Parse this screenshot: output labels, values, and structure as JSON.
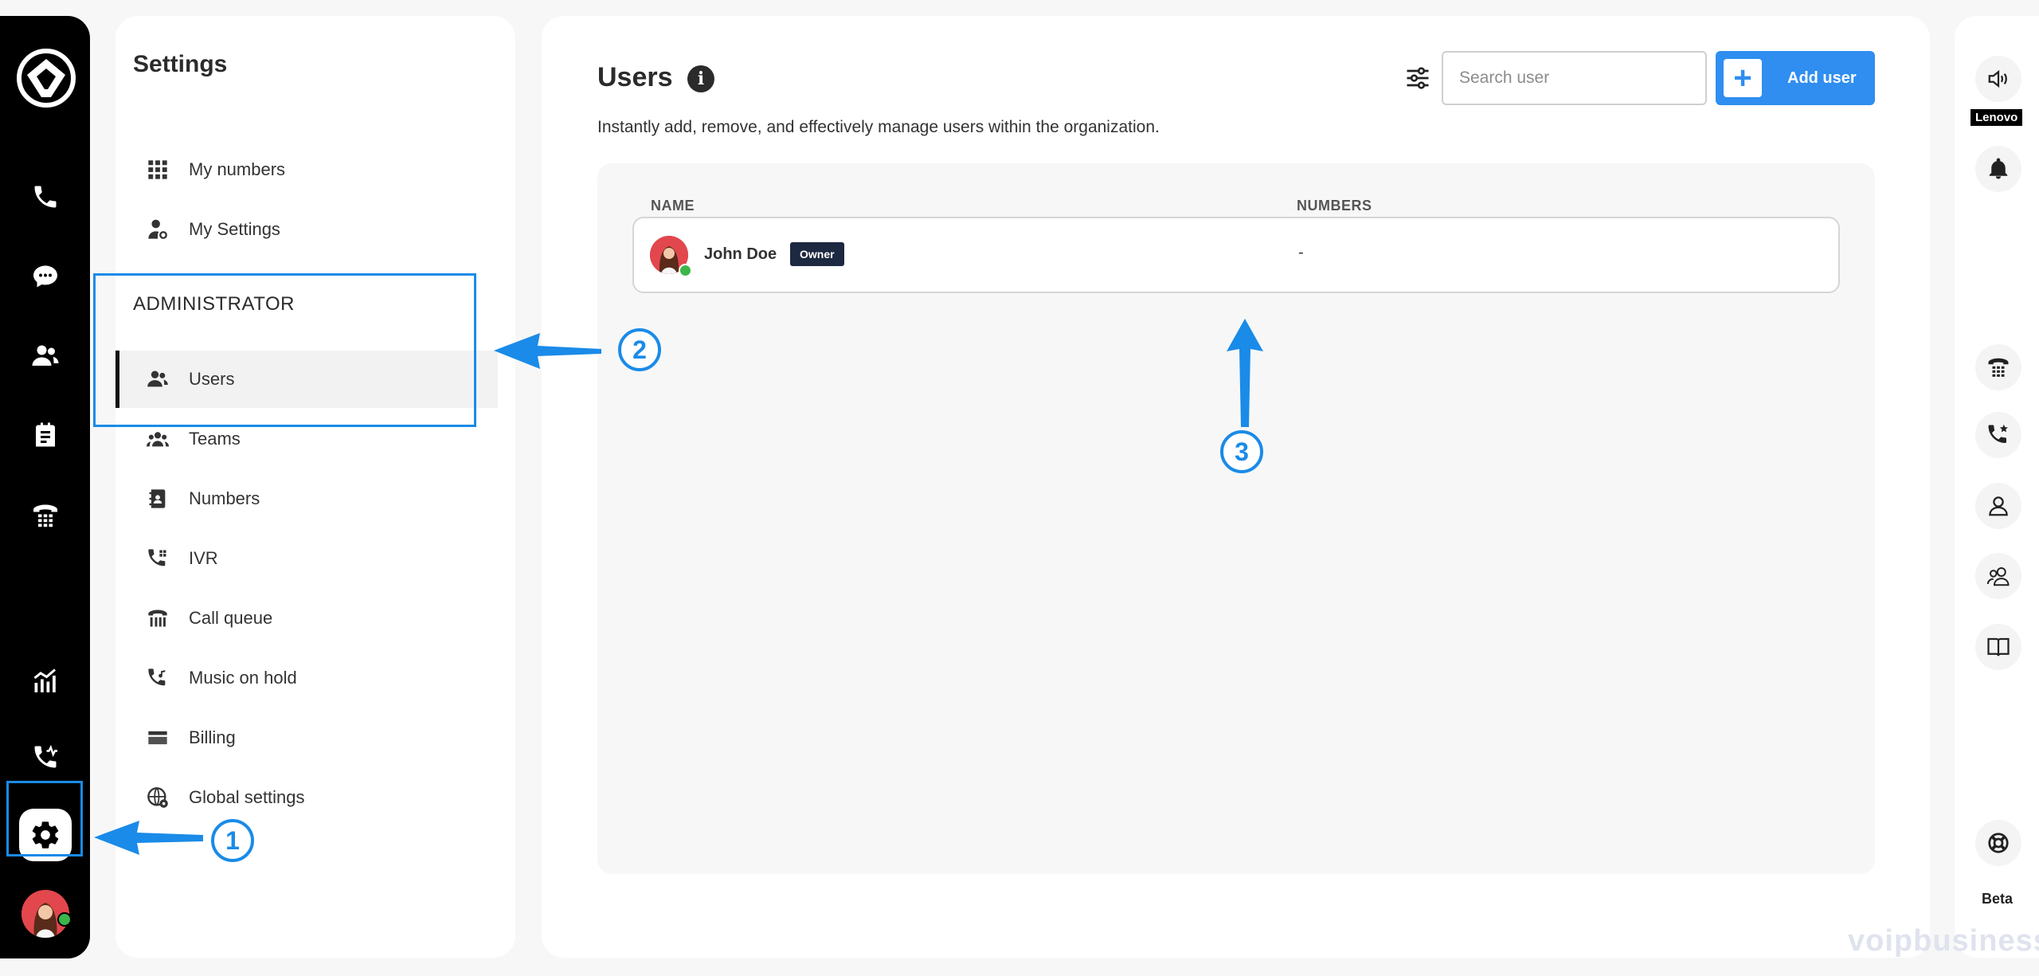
{
  "left_rail": {
    "icons": [
      "app-logo",
      "phone-icon",
      "chat-icon",
      "contacts-icon",
      "notes-icon",
      "dialpad-phone-icon",
      "analytics-icon",
      "call-activity-icon",
      "gear-icon"
    ]
  },
  "settings": {
    "title": "Settings",
    "personal_items": [
      {
        "label": "My numbers",
        "icon": "grid-icon"
      },
      {
        "label": "My Settings",
        "icon": "user-settings-icon"
      }
    ],
    "admin_heading": "ADMINISTRATOR",
    "admin_items": [
      {
        "label": "Users",
        "icon": "users-icon",
        "active": true
      },
      {
        "label": "Teams",
        "icon": "teams-icon"
      },
      {
        "label": "Numbers",
        "icon": "contact-book-icon"
      },
      {
        "label": "IVR",
        "icon": "ivr-icon"
      },
      {
        "label": "Call queue",
        "icon": "call-queue-icon"
      },
      {
        "label": "Music on hold",
        "icon": "music-hold-icon"
      },
      {
        "label": "Billing",
        "icon": "credit-card-icon"
      },
      {
        "label": "Global settings",
        "icon": "globe-settings-icon"
      }
    ]
  },
  "main": {
    "title": "Users",
    "description": "Instantly add, remove, and effectively manage users within the organization.",
    "search_placeholder": "Search user",
    "add_button": "Add user",
    "table": {
      "headers": [
        "NAME",
        "NUMBERS"
      ],
      "rows": [
        {
          "name": "John Doe",
          "badge": "Owner",
          "numbers": "-"
        }
      ]
    }
  },
  "right_rail": {
    "device_label": "Lenovo",
    "beta_label": "Beta",
    "icons": [
      "speaker-icon",
      "bell-icon",
      "dialpad-icon",
      "favorite-call-icon",
      "person-icon",
      "group-icon",
      "book-icon",
      "lifebuoy-icon"
    ]
  },
  "annotations": {
    "steps": [
      "1",
      "2",
      "3"
    ],
    "color": "#1a8be8"
  },
  "watermark": "voipbusiness",
  "colors": {
    "accent": "#2f8ef0",
    "badge": "#1d2841",
    "status_online": "#3cb54a",
    "avatar": "#e2474d"
  }
}
